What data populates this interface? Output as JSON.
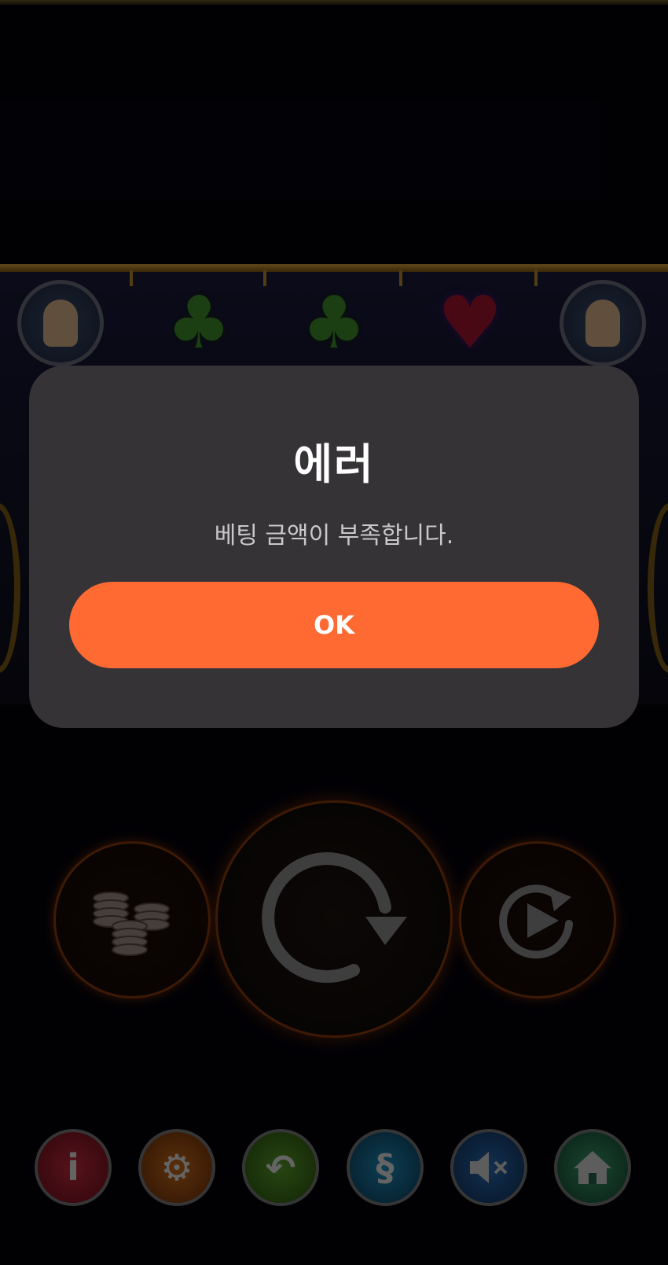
{
  "dialog": {
    "title": "에러",
    "message": "베팅 금액이 부족합니다.",
    "ok_label": "OK"
  },
  "colors": {
    "ok_button": "#ff6a33",
    "dialog_background": "#363337",
    "page_background": "#04030a"
  },
  "reel_symbols": [
    "card-player-portrait",
    "club-icon",
    "club-icon",
    "heart-icon",
    "dice-player-portrait"
  ],
  "controls": {
    "coins": "coins-icon",
    "spin": "spin-icon",
    "autoplay": "autoplay-icon"
  },
  "toolbar": {
    "info_glyph": "i",
    "rules_glyph": "§"
  }
}
